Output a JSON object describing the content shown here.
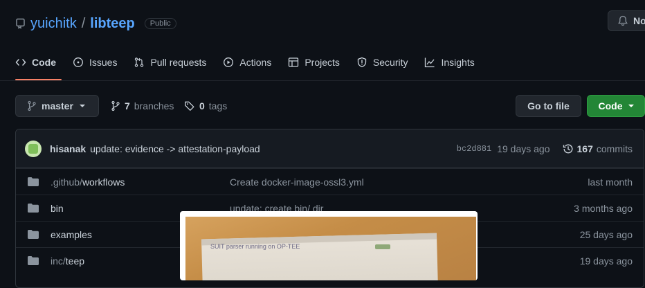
{
  "header": {
    "owner": "yuichitk",
    "separator": "/",
    "repo": "libteep",
    "visibility": "Public",
    "notifications_label": "No"
  },
  "tabs": [
    {
      "label": "Code",
      "icon": "code-icon",
      "active": true
    },
    {
      "label": "Issues",
      "icon": "issue-icon"
    },
    {
      "label": "Pull requests",
      "icon": "pull-request-icon"
    },
    {
      "label": "Actions",
      "icon": "play-icon"
    },
    {
      "label": "Projects",
      "icon": "table-icon"
    },
    {
      "label": "Security",
      "icon": "shield-icon"
    },
    {
      "label": "Insights",
      "icon": "graph-icon"
    }
  ],
  "toolbar": {
    "branch": "master",
    "branches_count": "7",
    "branches_label": "branches",
    "tags_count": "0",
    "tags_label": "tags",
    "go_to_file": "Go to file",
    "code_button": "Code"
  },
  "latest_commit": {
    "author": "hisanak",
    "message": "update: evidence -> attestation-payload",
    "sha": "bc2d881",
    "time": "19 days ago",
    "commit_count": "167",
    "commits_label": "commits"
  },
  "files": [
    {
      "name_prefix": ".github/",
      "name": "workflows",
      "message": "Create docker-image-ossl3.yml",
      "age": "last month"
    },
    {
      "name_prefix": "",
      "name": "bin",
      "message": "update: create bin/ dir",
      "age": "3 months ago"
    },
    {
      "name_prefix": "",
      "name": "examples",
      "message": "",
      "age": "25 days ago"
    },
    {
      "name_prefix": "inc/",
      "name": "teep",
      "message": "",
      "age": "19 days ago"
    }
  ],
  "overlay": {
    "photo_caption": "SUIT parser running on OP-TEE"
  },
  "colors": {
    "background": "#0d1117",
    "link": "#58a6ff",
    "accent_underline": "#f78166",
    "code_button": "#238636"
  }
}
